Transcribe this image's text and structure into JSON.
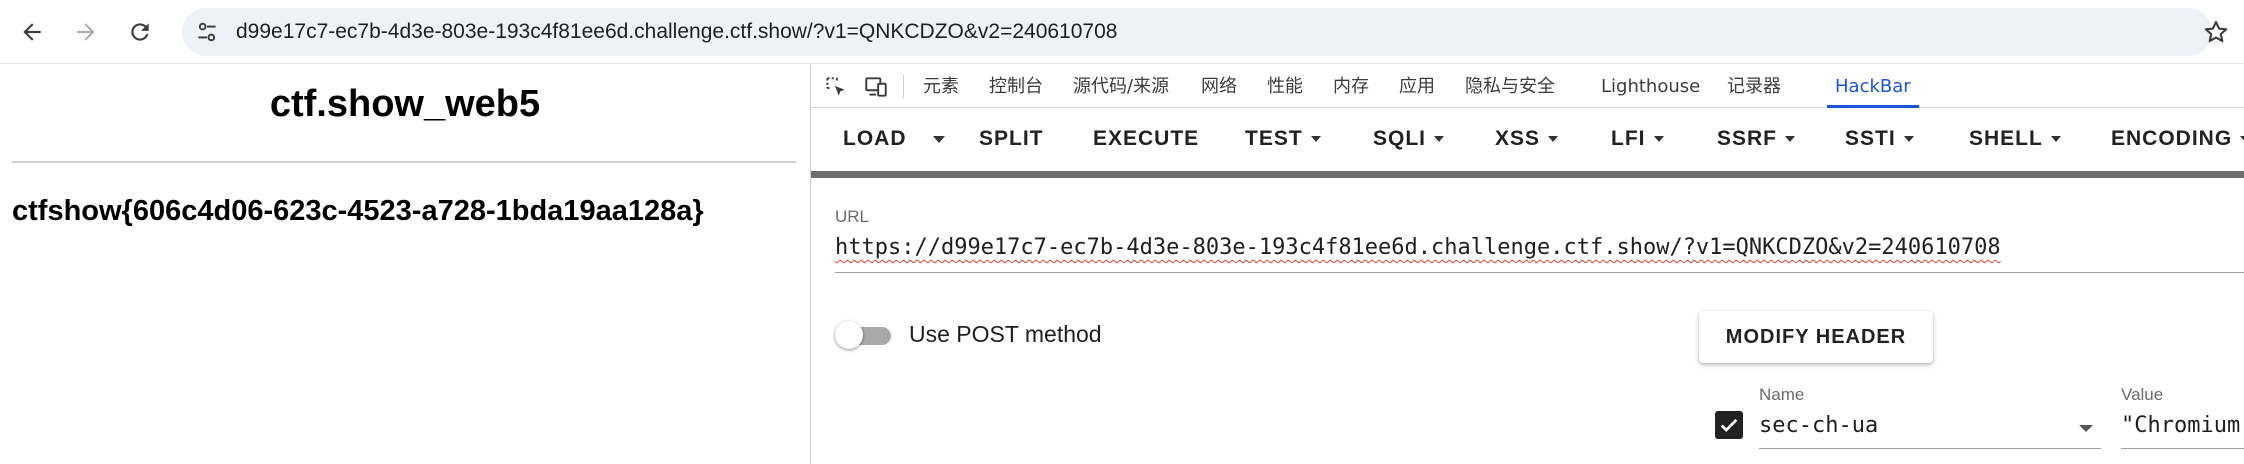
{
  "browser": {
    "address_bar_url": "d99e17c7-ec7b-4d3e-803e-193c4f81ee6d.challenge.ctf.show/?v1=QNKCDZO&v2=240610708",
    "icons": {
      "back": "back-arrow-icon",
      "forward": "forward-arrow-icon",
      "reload": "reload-icon",
      "site_settings": "tune-icon",
      "bookmark": "star-icon"
    }
  },
  "page": {
    "title": "ctf.show_web5",
    "flag": "ctfshow{606c4d06-623c-4523-a728-1bda19aa128a}"
  },
  "devtools": {
    "tabs": [
      "元素",
      "控制台",
      "源代码/来源",
      "网络",
      "性能",
      "内存",
      "应用",
      "隐私与安全",
      "Lighthouse",
      "记录器",
      "HackBar"
    ],
    "active_tab": "HackBar",
    "accent_color": "#1a56d1"
  },
  "hackbar": {
    "menu": {
      "load": "LOAD",
      "split": "SPLIT",
      "execute": "EXECUTE",
      "test": "TEST",
      "sqli": "SQLI",
      "xss": "XSS",
      "lfi": "LFI",
      "ssrf": "SSRF",
      "ssti": "SSTI",
      "shell": "SHELL",
      "encoding": "ENCODING"
    },
    "url_label": "URL",
    "url_value": "https://d99e17c7-ec7b-4d3e-803e-193c4f81ee6d.challenge.ctf.show/?v1=QNKCDZO&v2=240610708",
    "post_toggle_label": "Use POST method",
    "post_enabled": false,
    "modify_header_label": "MODIFY HEADER",
    "header": {
      "enabled": true,
      "name_label": "Name",
      "name_value": "sec-ch-ua",
      "value_label": "Value",
      "value_value": "\"Chromium"
    }
  }
}
